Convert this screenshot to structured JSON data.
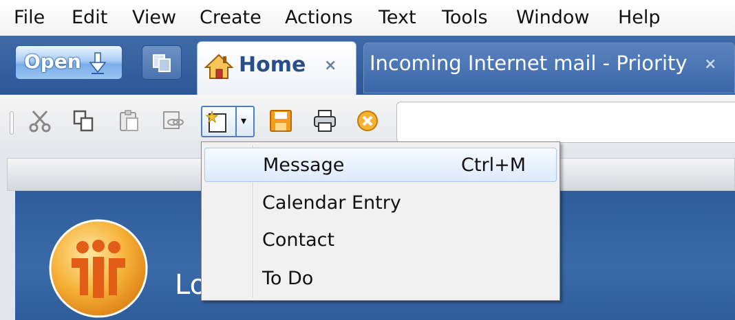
{
  "menubar": {
    "items": [
      "File",
      "Edit",
      "View",
      "Create",
      "Actions",
      "Text",
      "Tools",
      "Window",
      "Help"
    ]
  },
  "tabbar": {
    "open_label": "Open",
    "tabs": [
      {
        "label": "Home",
        "icon": "home-icon",
        "close": "×",
        "active": true
      },
      {
        "label": "Incoming Internet mail - Priority",
        "close": "×",
        "active": false
      }
    ]
  },
  "toolbar": {
    "icons": [
      "cut-icon",
      "copy-icon",
      "paste-icon",
      "copy-link-icon",
      "new-document-icon",
      "save-icon",
      "print-icon",
      "stop-icon"
    ],
    "search": {
      "value": ""
    }
  },
  "new_menu": {
    "items": [
      {
        "label": "Message",
        "shortcut": "Ctrl+M",
        "highlighted": true
      },
      {
        "label": "Calendar Entry",
        "shortcut": ""
      },
      {
        "label": "Contact",
        "shortcut": ""
      },
      {
        "label": "To Do",
        "shortcut": ""
      }
    ]
  },
  "welcome": {
    "text_fragment": "Lo"
  },
  "colors": {
    "tabbar": "#2d5796",
    "tab_home_text": "#2a4e86",
    "menu_highlight": "#dcebfc",
    "logo_orange": "#f39a1e",
    "content_blue": "#3a69a8"
  }
}
